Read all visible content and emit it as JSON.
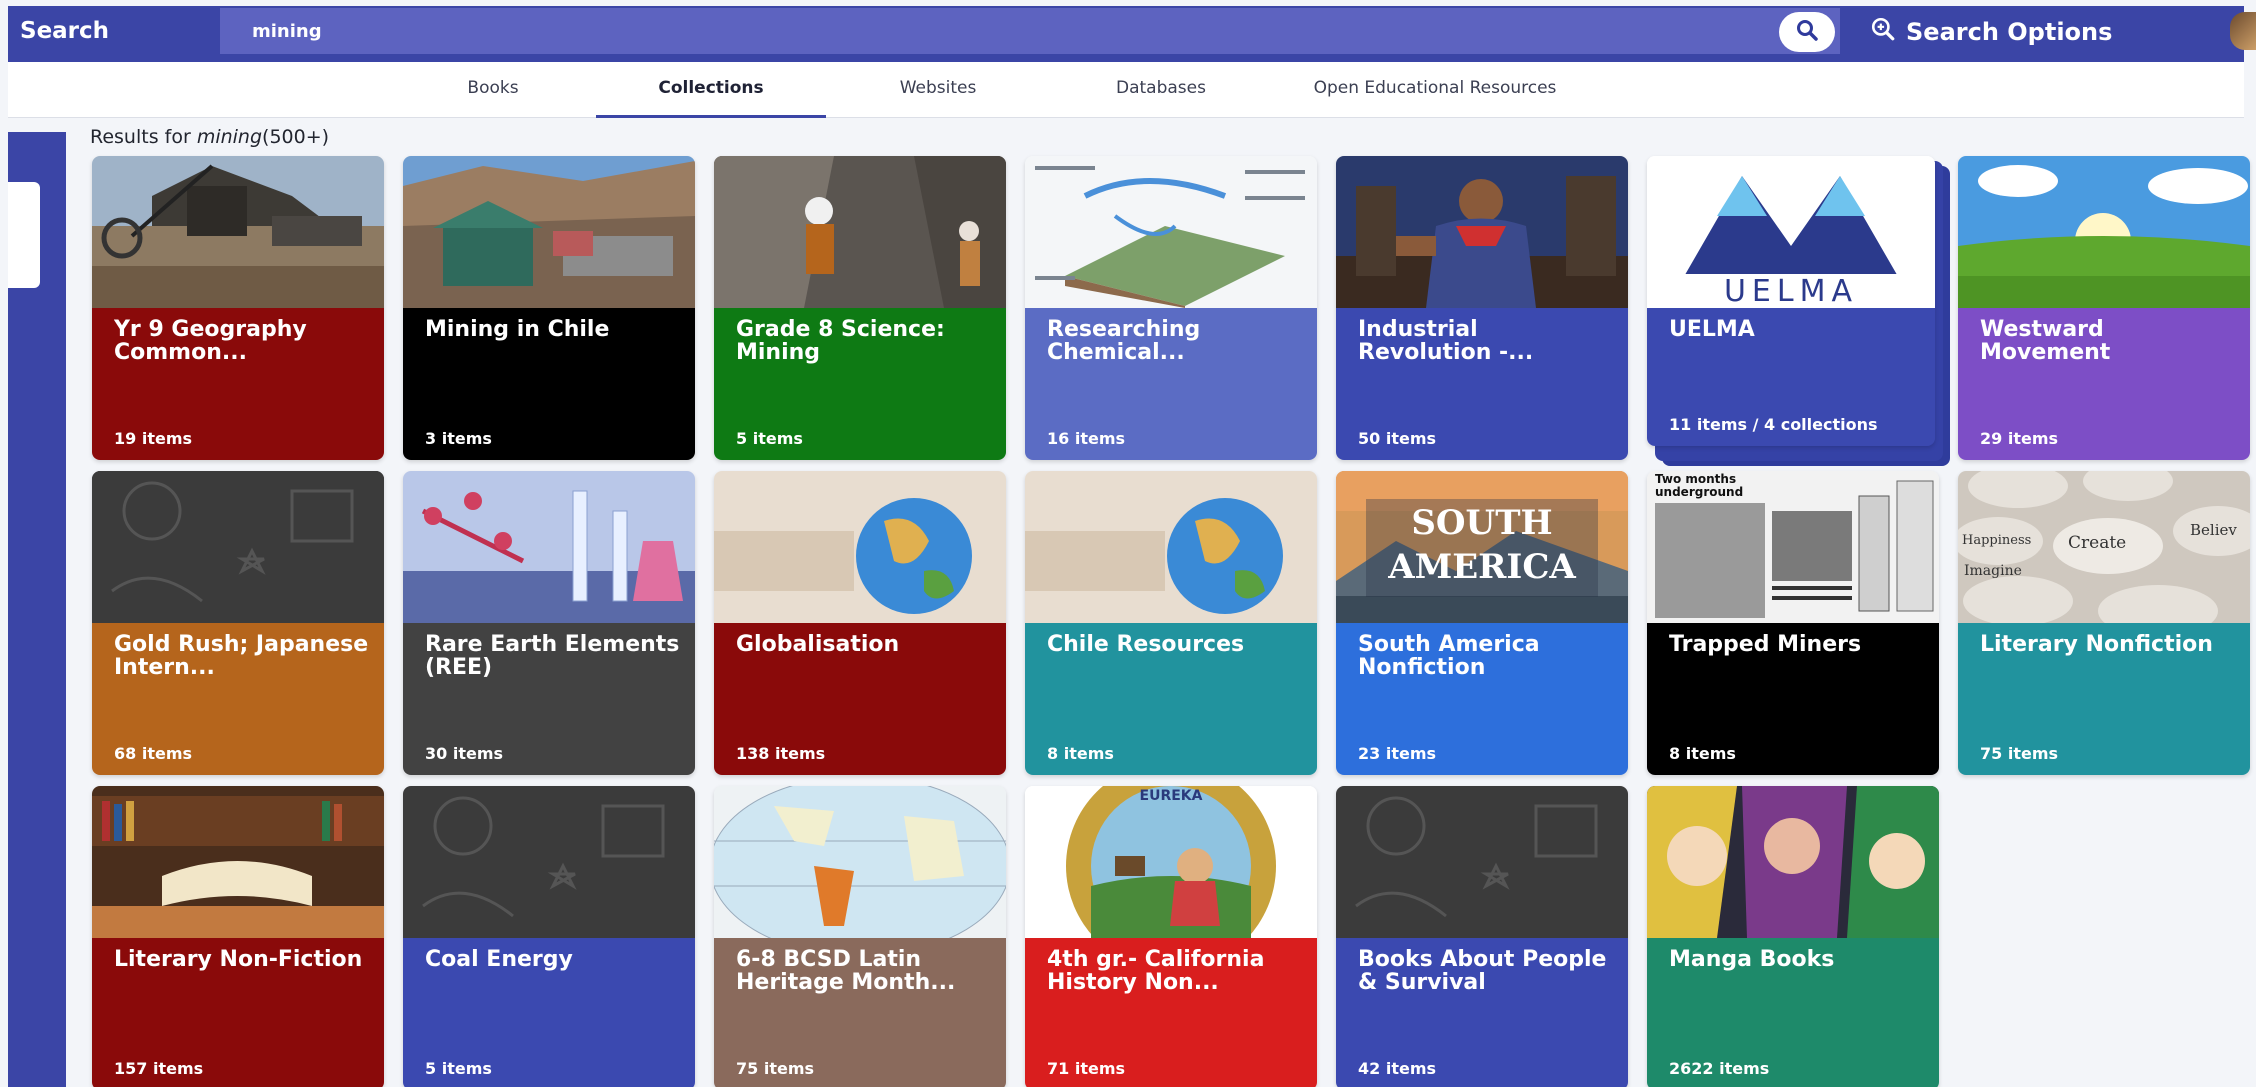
{
  "topbar": {
    "label": "Search",
    "query": "mining",
    "search_options_label": "Search Options"
  },
  "tabs": [
    {
      "label": "Books",
      "active": false
    },
    {
      "label": "Collections",
      "active": true
    },
    {
      "label": "Websites",
      "active": false
    },
    {
      "label": "Databases",
      "active": false
    },
    {
      "label": "Open Educational Resources",
      "active": false
    }
  ],
  "results": {
    "prefix": "Results for",
    "term": "mining",
    "count": "(500+)"
  },
  "cards": [
    {
      "title": "Yr 9 Geography Common...",
      "count": "19 items",
      "color": "#8a0a0a",
      "thumb": "mine-excavator"
    },
    {
      "title": "Mining in Chile",
      "count": "3 items",
      "color": "#000000",
      "thumb": "mountain-town"
    },
    {
      "title": "Grade 8 Science: Mining",
      "count": "5 items",
      "color": "#0e7a14",
      "thumb": "miners-tunnel"
    },
    {
      "title": "Researching Chemical...",
      "count": "16 items",
      "color": "#5b6cc4",
      "thumb": "water-cycle-diagram"
    },
    {
      "title": "Industrial Revolution -...",
      "count": "50 items",
      "color": "#3b49b0",
      "thumb": "industrial-worker"
    },
    {
      "title": "UELMA",
      "count": "11 items / 4 collections",
      "color": "#3b49b0",
      "thumb": "uelma-logo",
      "logo_text": "UELMA"
    },
    {
      "title": "Westward Movement",
      "count": "29 items",
      "color": "#7d4ec6",
      "thumb": "green-meadow"
    },
    {
      "title": "Gold Rush; Japanese Intern...",
      "count": "68 items",
      "color": "#b5651c",
      "thumb": "chalkboard"
    },
    {
      "title": "Rare Earth Elements (REE)",
      "count": "30 items",
      "color": "#424242",
      "thumb": "lab-glassware"
    },
    {
      "title": "Globalisation",
      "count": "138 items",
      "color": "#8a0a0a",
      "thumb": "globe"
    },
    {
      "title": "Chile Resources",
      "count": "8 items",
      "color": "#21939e",
      "thumb": "globe"
    },
    {
      "title": "South America Nonfiction",
      "count": "23 items",
      "color": "#2d6fdc",
      "thumb": "south-america",
      "thumb_text_1": "SOUTH",
      "thumb_text_2": "AMERICA"
    },
    {
      "title": "Trapped Miners",
      "count": "8 items",
      "color": "#000000",
      "thumb": "newspaper",
      "thumb_text_1": "Two months underground"
    },
    {
      "title": "Literary Nonfiction",
      "count": "75 items",
      "color": "#21939e",
      "thumb": "stones",
      "thumb_text_1": "Create",
      "thumb_text_2": "Imagine",
      "thumb_text_3": "Happiness",
      "thumb_text_4": "Believ"
    },
    {
      "title": "Literary Non-Fiction",
      "count": "157 items",
      "color": "#8a0a0a",
      "thumb": "books"
    },
    {
      "title": "Coal Energy",
      "count": "5 items",
      "color": "#3b49b0",
      "thumb": "chalkboard"
    },
    {
      "title": "6-8 BCSD Latin Heritage Month...",
      "count": "75 items",
      "color": "#8a6a5c",
      "thumb": "world-map"
    },
    {
      "title": "4th gr.- California History Non...",
      "count": "71 items",
      "color": "#d91e1e",
      "thumb": "california-seal",
      "thumb_text_1": "EUREKA"
    },
    {
      "title": "Books About People & Survival",
      "count": "42 items",
      "color": "#3b49b0",
      "thumb": "chalkboard"
    },
    {
      "title": "Manga Books",
      "count": "2622 items",
      "color": "#1e8a6a",
      "thumb": "manga"
    }
  ]
}
